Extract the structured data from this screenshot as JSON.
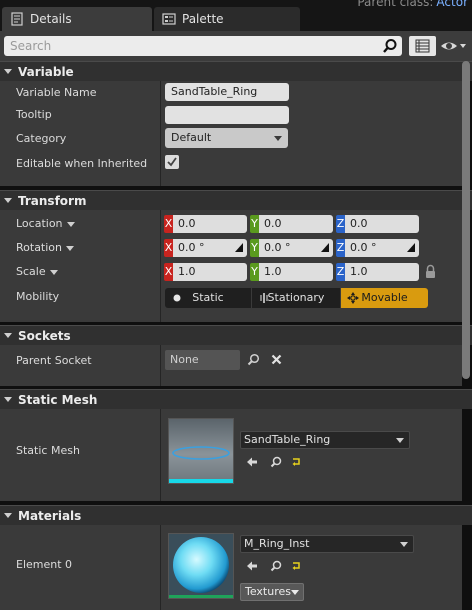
{
  "header": {
    "parent_class_label": "Parent class:",
    "parent_class_value": "Actor"
  },
  "tabs": [
    {
      "label": "Details",
      "icon": "details-icon"
    },
    {
      "label": "Palette",
      "icon": "palette-icon"
    }
  ],
  "search": {
    "placeholder": "Search"
  },
  "sections": {
    "variable": {
      "title": "Variable",
      "rows": {
        "name_label": "Variable Name",
        "name_value": "SandTable_Ring",
        "tooltip_label": "Tooltip",
        "tooltip_value": "",
        "category_label": "Category",
        "category_value": "Default",
        "editable_label": "Editable when Inherited",
        "editable_checked": true
      }
    },
    "transform": {
      "title": "Transform",
      "location": {
        "label": "Location",
        "x": "0.0",
        "y": "0.0",
        "z": "0.0"
      },
      "rotation": {
        "label": "Rotation",
        "x": "0.0 °",
        "y": "0.0 °",
        "z": "0.0 °"
      },
      "scale": {
        "label": "Scale",
        "x": "1.0",
        "y": "1.0",
        "z": "1.0"
      },
      "axis_labels": {
        "x": "X",
        "y": "Y",
        "z": "Z"
      },
      "mobility": {
        "label": "Mobility",
        "options": [
          "Static",
          "Stationary",
          "Movable"
        ],
        "selected": "Movable"
      }
    },
    "sockets": {
      "title": "Sockets",
      "parent_socket_label": "Parent Socket",
      "parent_socket_value": "None"
    },
    "static_mesh": {
      "title": "Static Mesh",
      "label": "Static Mesh",
      "asset": "SandTable_Ring"
    },
    "materials": {
      "title": "Materials",
      "element_label": "Element 0",
      "asset": "M_Ring_Inst",
      "textures_button": "Textures"
    }
  },
  "colors": {
    "movable_accent": "#d99b0f",
    "axis_x": "#c8241f",
    "axis_y": "#5a9a1e",
    "axis_z": "#2a63c9"
  }
}
